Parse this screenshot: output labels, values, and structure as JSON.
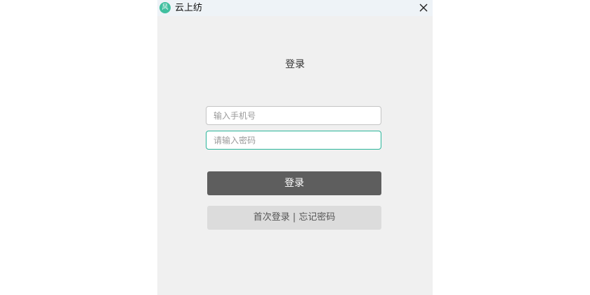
{
  "window": {
    "title": "云上纺",
    "icon": "app-logo-icon",
    "close_icon": "close-icon"
  },
  "login": {
    "heading": "登录",
    "phone_placeholder": "输入手机号",
    "password_placeholder": "请输入密码",
    "submit_label": "登录",
    "first_login_label": "首次登录",
    "separator": " | ",
    "forgot_password_label": "忘记密码"
  },
  "colors": {
    "accent": "#2bb59a",
    "primary_button": "#5e5e5e",
    "secondary_button": "#dcdcdc",
    "window_bg": "#f0f0f0"
  }
}
